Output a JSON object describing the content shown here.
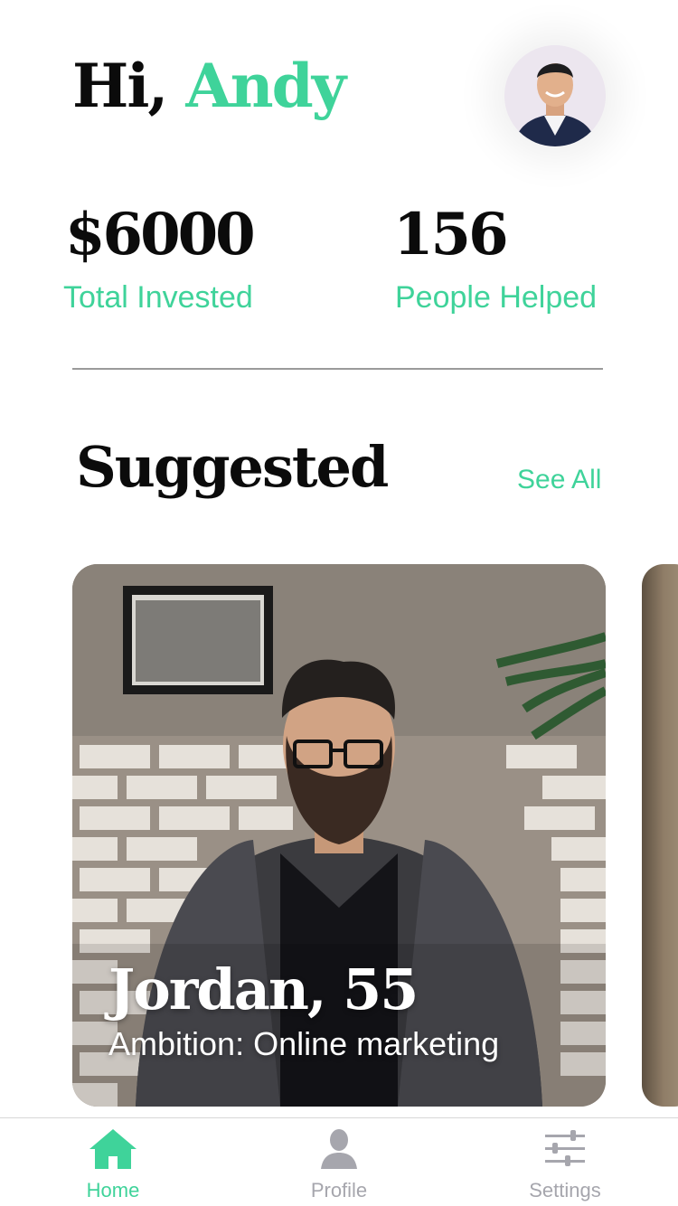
{
  "greeting": {
    "prefix": "Hi, ",
    "name": "Andy"
  },
  "stats": [
    {
      "value": "$6000",
      "label": "Total Invested"
    },
    {
      "value": "156",
      "label": "People Helped"
    }
  ],
  "suggested": {
    "title": "Suggested",
    "see_all": "See All",
    "cards": [
      {
        "title": "Jordan, 55",
        "subtitle": "Ambition: Online marketing"
      }
    ]
  },
  "tabbar": {
    "tabs": [
      {
        "label": "Home",
        "icon": "home-icon",
        "active": true
      },
      {
        "label": "Profile",
        "icon": "user-icon",
        "active": false
      },
      {
        "label": "Settings",
        "icon": "sliders-icon",
        "active": false
      }
    ]
  },
  "colors": {
    "accent": "#3fd39a",
    "text": "#0b0b0b",
    "inactive": "#a6a6ad"
  }
}
